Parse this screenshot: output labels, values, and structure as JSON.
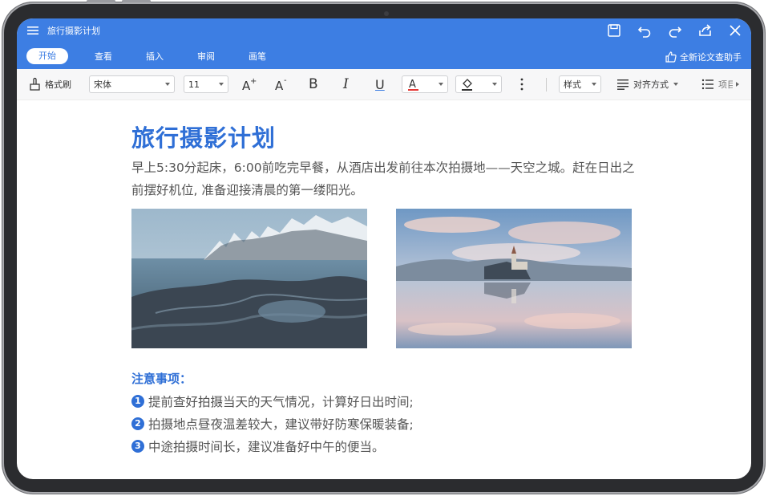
{
  "app": {
    "doc_title": "旅行摄影计划",
    "tabs": [
      {
        "label": "开始",
        "active": true
      },
      {
        "label": "查看",
        "active": false
      },
      {
        "label": "插入",
        "active": false
      },
      {
        "label": "审阅",
        "active": false
      },
      {
        "label": "画笔",
        "active": false
      }
    ],
    "help_label": "全新论文查助手",
    "accent_color": "#3d7ee3"
  },
  "toolbar": {
    "format_painter": "格式刷",
    "font_family": "宋体",
    "font_size": "11",
    "bold": "B",
    "italic": "I",
    "underline": "U",
    "styles_label": "样式",
    "align_label": "对齐方式",
    "list_label": "项目"
  },
  "document": {
    "heading": "旅行摄影计划",
    "paragraph": "早上5:30分起床，6:00前吃完早餐，从酒店出发前往本次拍摄地——天空之城。赶在日出之前摆好机位, 准备迎接清晨的第一缕阳光。",
    "notes_title": "注意事项：",
    "notes": [
      {
        "num": "1",
        "text": "提前查好拍摄当天的天气情况，计算好日出时间;"
      },
      {
        "num": "2",
        "text": "拍摄地点昼夜温差较大，建议带好防寒保暖装备;"
      },
      {
        "num": "3",
        "text": "中途拍摄时间长，建议准备好中午的便当。"
      }
    ]
  }
}
